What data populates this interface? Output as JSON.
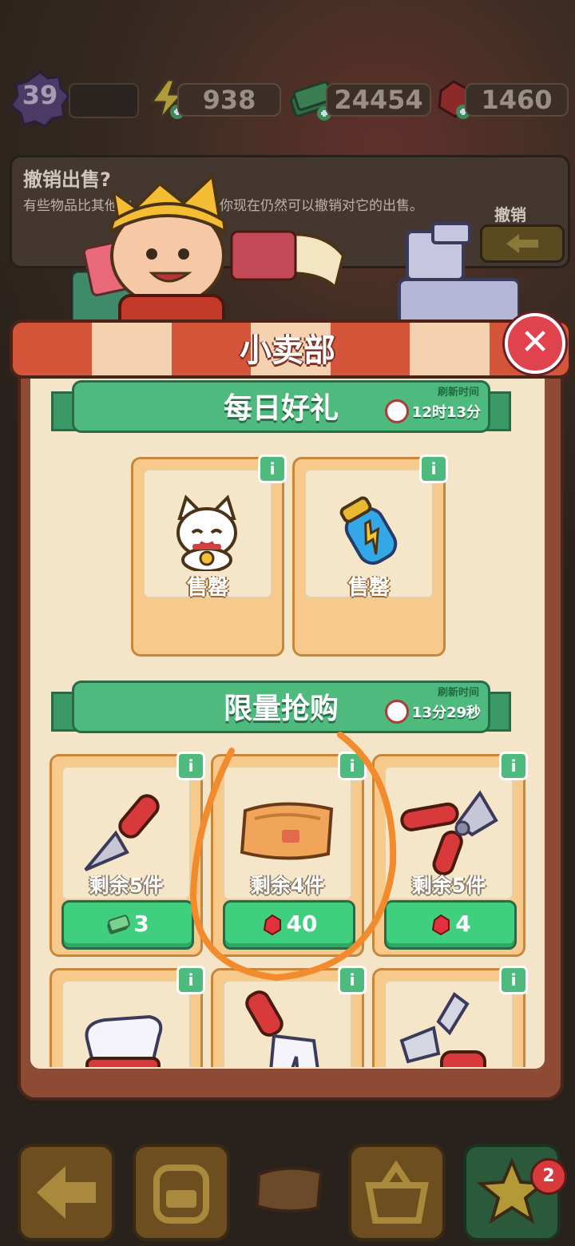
{
  "resources": {
    "level": "39",
    "energy": "938",
    "cash": "24454",
    "gems": "1460"
  },
  "undo_panel": {
    "title": "撤销出售?",
    "description_left": "有些物品比其他物",
    "description_right": "你现在仍然可以撤销对它的出售。",
    "button_label": "撤销"
  },
  "shop": {
    "title": "小卖部",
    "daily": {
      "label": "每日好礼",
      "refresh_title": "刷新时间",
      "refresh_time": "12时13分",
      "items": [
        {
          "icon": "lucky-cat-icon",
          "status": "售罄"
        },
        {
          "icon": "energy-bottle-icon",
          "status": "售罄"
        }
      ]
    },
    "limited": {
      "label": "限量抢购",
      "refresh_title": "刷新时间",
      "refresh_time": "13分29秒",
      "items": [
        {
          "icon": "trowel-icon",
          "remaining": "剩余5件",
          "currency": "cash-icon",
          "price": "3"
        },
        {
          "icon": "orange-bag-icon",
          "remaining": "剩余4件",
          "currency": "gem-icon",
          "price": "40"
        },
        {
          "icon": "pruning-shears-icon",
          "remaining": "剩余5件",
          "currency": "gem-icon",
          "price": "4"
        },
        {
          "icon": "garden-glove-icon"
        },
        {
          "icon": "hand-fork-icon"
        },
        {
          "icon": "scissors-icon"
        }
      ]
    }
  },
  "bottom_bar": {
    "star_badge": "2"
  },
  "colors": {
    "green": "#4fba7e",
    "buy_green": "#3fcf7f",
    "gem_red": "#e0313c",
    "card_orange": "#f7c98b",
    "annotation_orange": "#f28a2e"
  }
}
